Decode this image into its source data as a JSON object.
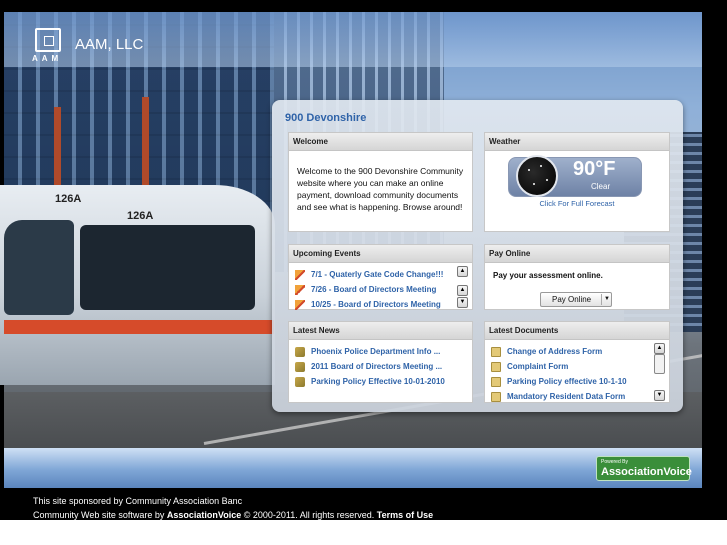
{
  "header": {
    "logo_text": "AAM",
    "site_title": "AAM, LLC"
  },
  "photo": {
    "tram_number_1": "126A",
    "tram_number_2": "126A"
  },
  "panel": {
    "title": "900 Devonshire",
    "welcome": {
      "heading": "Welcome",
      "text": "Welcome to the 900 Devonshire Community website where you can make an online payment, download community documents and see what is happening. Browse around!"
    },
    "weather": {
      "heading": "Weather",
      "temperature": "90°F",
      "condition": "Clear",
      "forecast_link": "Click For Full Forecast",
      "icon": "moon-icon"
    },
    "events": {
      "heading": "Upcoming Events",
      "items": [
        "7/1 - Quaterly Gate Code Change!!!",
        "7/26 - Board of Directors Meeting",
        "10/25 - Board of Directors Meeting"
      ]
    },
    "pay_online": {
      "heading": "Pay Online",
      "text": "Pay your assessment online.",
      "button": "Pay Online"
    },
    "news": {
      "heading": "Latest News",
      "items": [
        "Phoenix Police Department Info ...",
        "2011 Board of Directors Meeting ...",
        "Parking Policy Effective 10-01-2010"
      ]
    },
    "documents": {
      "heading": "Latest Documents",
      "items": [
        "Change of Address Form",
        "Complaint Form",
        "Parking Policy effective 10-1-10",
        "Mandatory Resident Data Form"
      ]
    }
  },
  "badge": {
    "small": "Powered By",
    "brand": "AssociationVoice"
  },
  "footer": {
    "line1": "This site sponsored by Community Association Banc",
    "line2_prefix": "Community Web site software by ",
    "line2_brand": "AssociationVoice",
    "line2_suffix": " © 2000-2011. All rights reserved. ",
    "terms": "Terms of Use"
  },
  "colors": {
    "link": "#2f63a8",
    "badge_green": "#3a8e3a"
  }
}
